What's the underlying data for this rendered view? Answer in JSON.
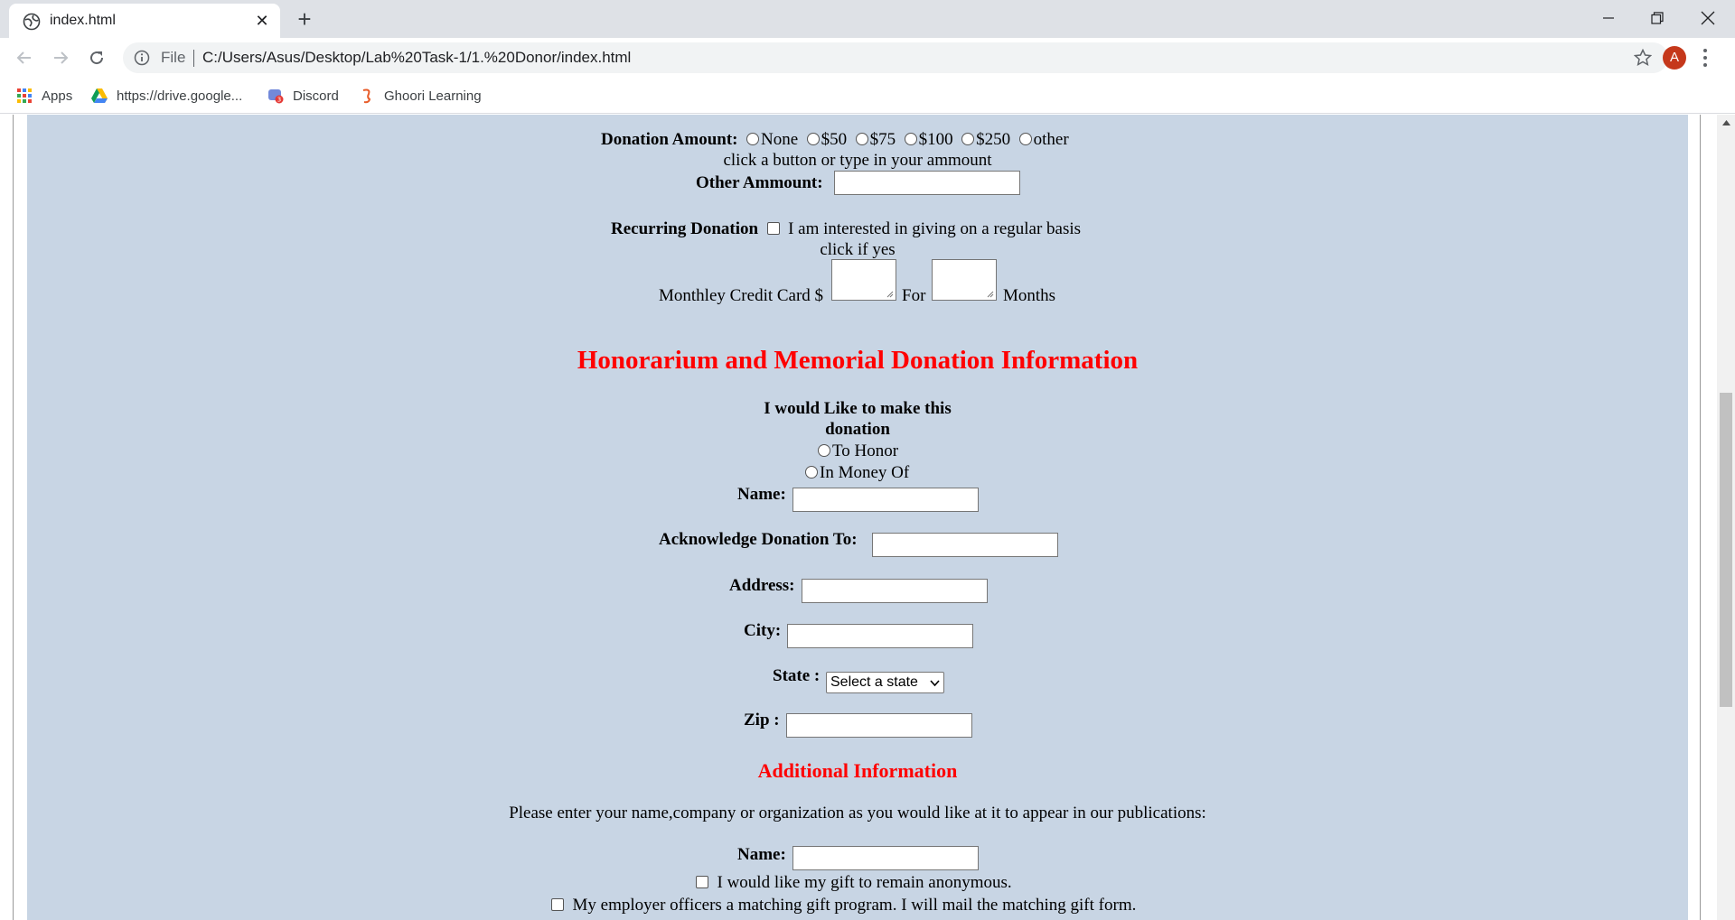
{
  "browser": {
    "tab_title": "index.html",
    "new_tab_label": "+",
    "address_scheme": "File",
    "url": "C:/Users/Asus/Desktop/Lab%20Task-1/1.%20Donor/index.html",
    "profile_initial": "A",
    "bookmarks": [
      {
        "label": "Apps",
        "icon": "apps-grid-icon"
      },
      {
        "label": "https://drive.google...",
        "icon": "google-drive-icon"
      },
      {
        "label": "Discord",
        "icon": "discord-icon"
      },
      {
        "label": "Ghoori Learning",
        "icon": "ghoori-learning-icon"
      }
    ]
  },
  "donation": {
    "amount_label": "Donation Amount:",
    "amount_options": [
      "None",
      "$50",
      "$75",
      "$100",
      "$250",
      "other"
    ],
    "amount_hint": "click a button or type in your ammount",
    "other_amount_label": "Other Ammount:",
    "other_amount_value": "",
    "recurring_label": "Recurring Donation",
    "recurring_text": "I am interested in giving on a regular basis",
    "recurring_hint": "click if yes",
    "monthly_label": "Monthley Credit Card $",
    "for_label": "For",
    "months_label": "Months"
  },
  "honorarium": {
    "heading": "Honorarium and Memorial Donation Information",
    "make_donation_line1": "I would Like to make this",
    "make_donation_line2": "donation",
    "options": [
      "To Honor",
      "In Money Of"
    ],
    "name_label": "Name:",
    "acknowledge_label": "Acknowledge Donation To:",
    "address_label": "Address:",
    "city_label": "City:",
    "state_label": "State :",
    "state_selected": "Select a state",
    "zip_label": "Zip :"
  },
  "additional": {
    "heading": "Additional Information",
    "instructions": "Please enter your name,company or organization as you would like at it to appear in our publications:",
    "name_label": "Name:",
    "anonymous_text": "I would like my gift to remain anonymous.",
    "matching_text": "My employer officers a matching gift program. I will mail the matching gift form."
  },
  "colors": {
    "page_background": "#c8d5e4",
    "heading_red": "#ff0000"
  }
}
